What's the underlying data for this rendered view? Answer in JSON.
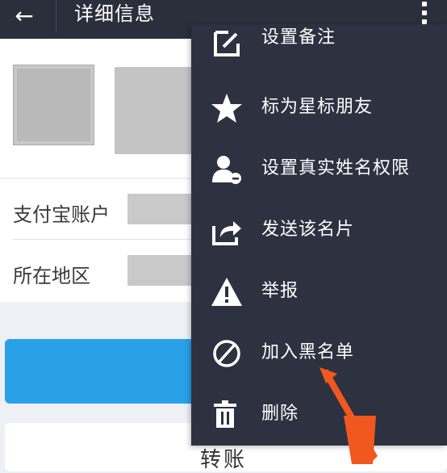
{
  "header": {
    "back_icon": "←",
    "title": "详细信息"
  },
  "info": {
    "alipay_label": "支付宝账户",
    "region_label": "所在地区"
  },
  "bottom": {
    "transfer_label": "转账"
  },
  "menu": {
    "items": [
      {
        "label": "设置备注",
        "icon": "edit-icon"
      },
      {
        "label": "标为星标朋友",
        "icon": "star-icon"
      },
      {
        "label": "设置真实姓名权限",
        "icon": "user-minus-icon"
      },
      {
        "label": "发送该名片",
        "icon": "share-icon"
      },
      {
        "label": "举报",
        "icon": "warning-icon"
      },
      {
        "label": "加入黑名单",
        "icon": "block-icon"
      },
      {
        "label": "删除",
        "icon": "trash-icon"
      }
    ]
  },
  "colors": {
    "topbar": "#2b2e3b",
    "menu_bg": "#2d3140",
    "primary_button": "#2aa0e9",
    "annotation_arrow": "#f0581f"
  }
}
